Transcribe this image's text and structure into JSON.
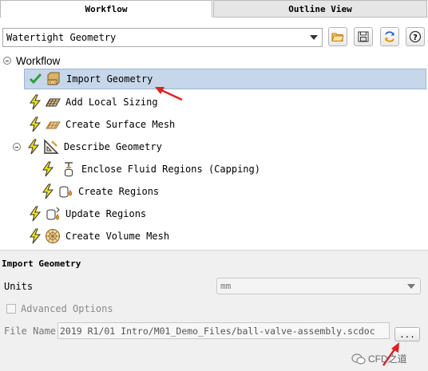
{
  "tabs": [
    {
      "label": "Workflow",
      "active": true
    },
    {
      "label": "Outline View",
      "active": false
    }
  ],
  "toolbar": {
    "workflow_select": "Watertight Geometry",
    "buttons": [
      "open-folder-icon",
      "save-icon",
      "refresh-icon",
      "help-icon"
    ],
    "help_glyph": "?"
  },
  "tree": {
    "root_label": "Workflow",
    "items": [
      {
        "label": "Import Geometry",
        "status": "completed",
        "icon": "cad-import-icon",
        "selected": true
      },
      {
        "label": "Add Local Sizing",
        "status": "pending",
        "icon": "local-sizing-icon"
      },
      {
        "label": "Create Surface Mesh",
        "status": "pending",
        "icon": "surface-mesh-icon"
      },
      {
        "label": "Describe Geometry",
        "status": "pending",
        "icon": "describe-geometry-icon",
        "expanded": true
      },
      {
        "label": "Enclose Fluid Regions (Capping)",
        "status": "pending",
        "icon": "capping-icon"
      },
      {
        "label": "Create Regions",
        "status": "pending",
        "icon": "create-regions-icon"
      },
      {
        "label": "Update Regions",
        "status": "pending",
        "icon": "update-regions-icon"
      },
      {
        "label": "Create Volume Mesh",
        "status": "pending",
        "icon": "volume-mesh-icon"
      }
    ]
  },
  "task_panel": {
    "title": "Import Geometry",
    "units_label": "Units",
    "units_value": "mm",
    "advanced_options_label": "Advanced Options",
    "advanced_options_checked": false,
    "file_name_label": "File Name",
    "file_name_value": "2019 R1/01 Intro/M01_Demo_Files/ball-valve-assembly.scdoc",
    "browse_label": "..."
  },
  "watermark": {
    "text": "CFD之道"
  },
  "colors": {
    "selected_row": "#c7d7ea",
    "check_green": "#2e9e3e",
    "lightning_yellow": "#f2e21a",
    "annotation_arrow": "#e02020",
    "panel_bg": "#f0f0f0"
  }
}
